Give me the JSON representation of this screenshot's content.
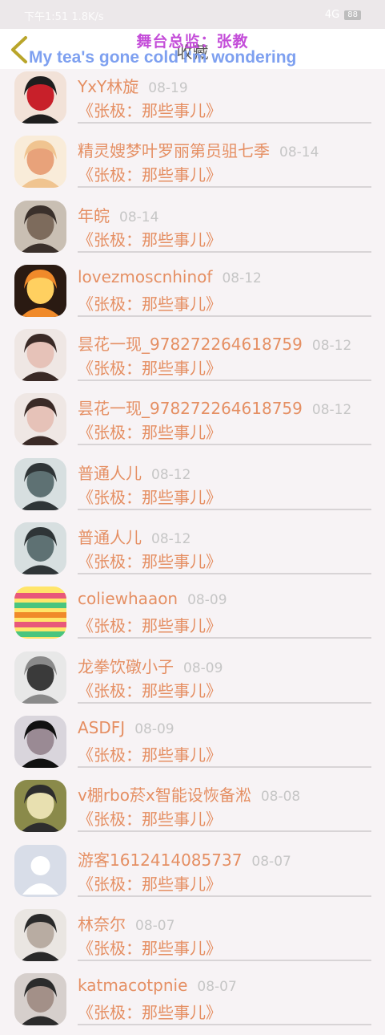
{
  "status_bar": {
    "left_text": "下午1:51 1.8K/s",
    "right_text": "4G",
    "battery": "88"
  },
  "header": {
    "title": "收藏",
    "overlay_line1": "舞台总监：张教",
    "overlay_line2": "My tea's gone cold I'm wondering"
  },
  "rows": [
    {
      "name": "YxY林旋",
      "date": "08-19",
      "song": "《张极：那些事儿》",
      "avatar": "girl-red-bow-cartoon-avatar"
    },
    {
      "name": "精灵嫂梦叶罗丽第员驵七季",
      "date": "08-14",
      "song": "《张极：那些事儿》",
      "avatar": "anime-girl-blonde-avatar"
    },
    {
      "name": "年皖",
      "date": "08-14",
      "song": "《张极：那些事儿》",
      "avatar": "portrait-photo-avatar"
    },
    {
      "name": "lovezmoscnhinof",
      "date": "08-12",
      "song": "《张极：那些事儿》",
      "avatar": "man-with-fire-avatar"
    },
    {
      "name": "昙花一现_978272264618759",
      "date": "08-12",
      "song": "《张极：那些事儿》",
      "avatar": "girl-selfie-avatar"
    },
    {
      "name": "昙花一现_978272264618759",
      "date": "08-12",
      "song": "《张极：那些事儿》",
      "avatar": "girl-selfie-avatar"
    },
    {
      "name": "普通人儿",
      "date": "08-12",
      "song": "《张极：那些事儿》",
      "avatar": "ninja-mask-avatar"
    },
    {
      "name": "普通人儿",
      "date": "08-12",
      "song": "《张极：那些事儿》",
      "avatar": "ninja-mask-avatar"
    },
    {
      "name": "coliewhaaon",
      "date": "08-09",
      "song": "《张极：那些事儿》",
      "avatar": "colorful-stripes-avatar"
    },
    {
      "name": "龙拳饮礅小子",
      "date": "08-09",
      "song": "《张极：那些事儿》",
      "avatar": "grayscale-hand-avatar"
    },
    {
      "name": "ASDFJ",
      "date": "08-09",
      "song": "《张极：那些事儿》",
      "avatar": "dark-hair-girl-avatar"
    },
    {
      "name": "v棚rbo菸x智能设恢备淞",
      "date": "08-08",
      "song": "《张极：那些事儿》",
      "avatar": "cartoon-character-avatar"
    },
    {
      "name": "游客1612414085737",
      "date": "08-07",
      "song": "《张极：那些事儿》",
      "avatar": "default-user-avatar"
    },
    {
      "name": "林奈尔",
      "date": "08-07",
      "song": "《张极：那些事儿》",
      "avatar": "girl-back-view-avatar"
    },
    {
      "name": "katmacotpnie",
      "date": "08-07",
      "song": "《张极：那些事儿》",
      "avatar": "hand-photo-avatar"
    }
  ],
  "colors": {
    "accent_orange": "#e58f63",
    "date_gray": "#c6c6c6",
    "back_arrow": "#b9a52a",
    "overlay_purple": "#c44ed9",
    "overlay_blue": "#7ea0f0"
  }
}
